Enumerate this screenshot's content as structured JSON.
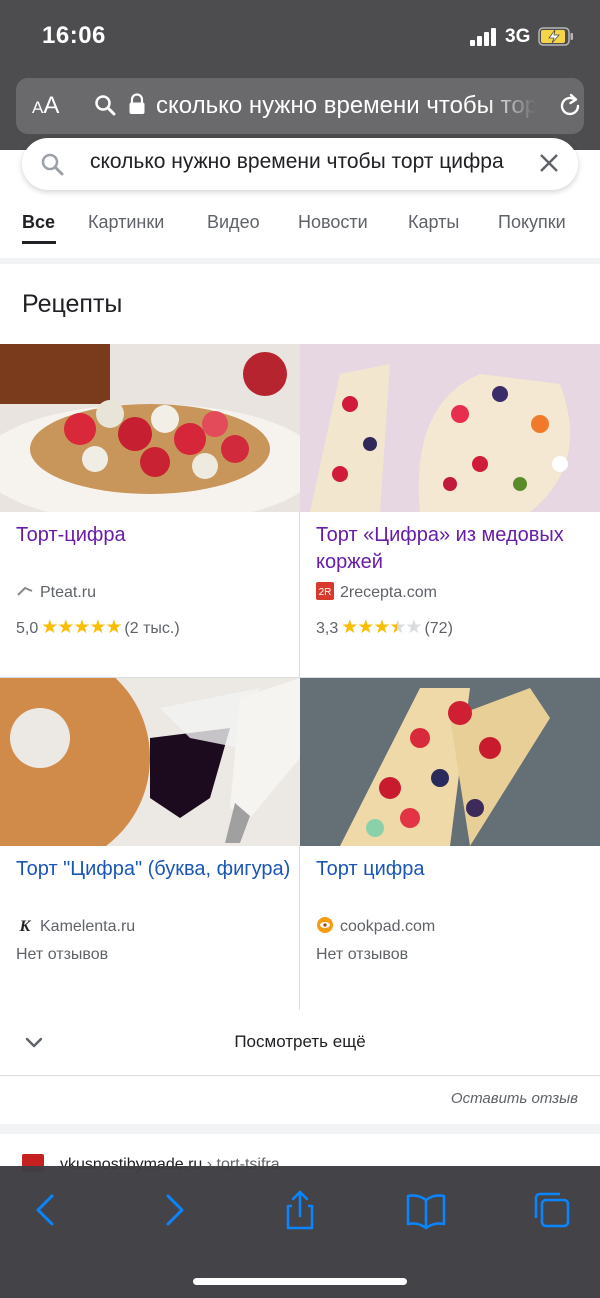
{
  "status": {
    "time": "16:06",
    "network": "3G"
  },
  "address_bar": {
    "text_size_label": "AA",
    "url_text": "сколько нужно времени чтобы торт цифра"
  },
  "search": {
    "query": "сколько нужно времени чтобы торт цифра"
  },
  "tabs": [
    {
      "label": "Все",
      "active": true
    },
    {
      "label": "Картинки"
    },
    {
      "label": "Видео"
    },
    {
      "label": "Новости"
    },
    {
      "label": "Карты"
    },
    {
      "label": "Покупки"
    }
  ],
  "recipes": {
    "title": "Рецепты",
    "items": [
      {
        "title": "Торт-цифра",
        "source": "Pteat.ru",
        "rating": "5,0",
        "stars": 5,
        "reviews": "(2 тыс.)",
        "visited": true
      },
      {
        "title": "Торт «Цифра» из медовых коржей",
        "source": "2recepta.com",
        "source_icon_text": "2R",
        "rating": "3,3",
        "stars": 3.5,
        "reviews": "(72)",
        "visited": true
      },
      {
        "title": "Торт \"Цифра\" (буква, фигура)",
        "source": "Kamelenta.ru",
        "source_icon_text": "K",
        "no_reviews": "Нет отзывов",
        "visited": false
      },
      {
        "title": "Торт цифра",
        "source": "cookpad.com",
        "no_reviews": "Нет отзывов",
        "visited": false
      }
    ],
    "more_label": "Посмотреть ещё",
    "feedback_label": "Оставить отзыв"
  },
  "next_result": {
    "site": "vkusnostibymade.ru",
    "path": " › tort-tsifra"
  },
  "colors": {
    "link_visited": "#681da8",
    "link": "#1a56b8",
    "star": "#fbbc04",
    "toolbar_icon": "#0a84ff"
  },
  "toolbar": {
    "icons": [
      "back-icon",
      "forward-icon",
      "share-icon",
      "bookmarks-icon",
      "tabs-icon"
    ]
  }
}
